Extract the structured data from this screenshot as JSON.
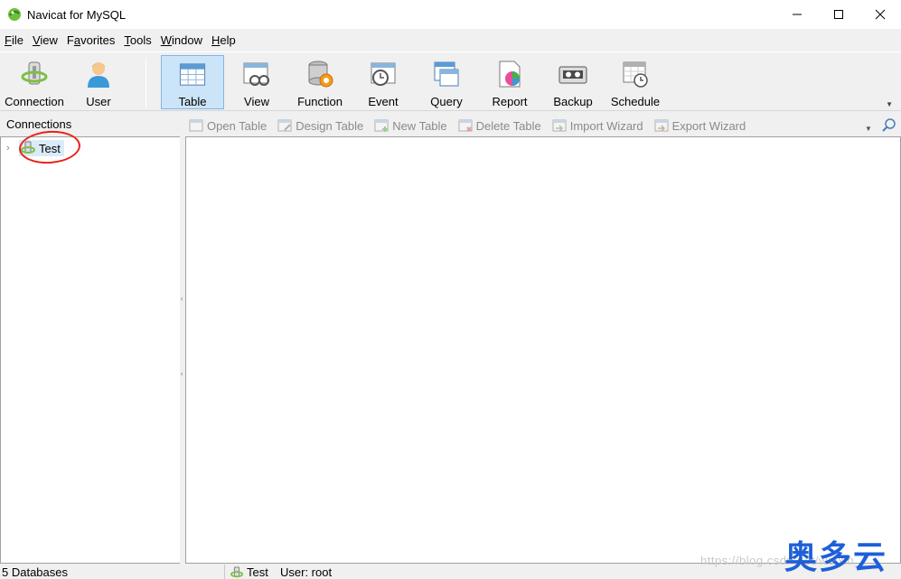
{
  "window": {
    "title": "Navicat for MySQL"
  },
  "menu": [
    {
      "key": "F",
      "rest": "ile"
    },
    {
      "key": "V",
      "rest": "iew"
    },
    {
      "pre": "F",
      "key": "a",
      "rest": "vorites"
    },
    {
      "key": "T",
      "rest": "ools"
    },
    {
      "key": "W",
      "rest": "indow"
    },
    {
      "key": "H",
      "rest": "elp"
    }
  ],
  "toolbar": {
    "connection": "Connection",
    "user": "User",
    "table": "Table",
    "view": "View",
    "function": "Function",
    "event": "Event",
    "query": "Query",
    "report": "Report",
    "backup": "Backup",
    "schedule": "Schedule",
    "active": "table"
  },
  "connections_header": "Connections",
  "object_toolbar": {
    "open_table": "Open Table",
    "design_table": "Design Table",
    "new_table": "New Table",
    "delete_table": "Delete Table",
    "import_wizard": "Import Wizard",
    "export_wizard": "Export Wizard"
  },
  "tree": {
    "connection_name": "Test"
  },
  "status": {
    "databases": "5 Databases",
    "connection": "Test",
    "user": "User: root"
  },
  "watermark": {
    "url": "https://blog.csdn.net/weixin_",
    "brand": "奥多云"
  },
  "colors": {
    "accent": "#cce4f7",
    "annotation": "#e8231a",
    "brand": "#1e5fd8"
  }
}
